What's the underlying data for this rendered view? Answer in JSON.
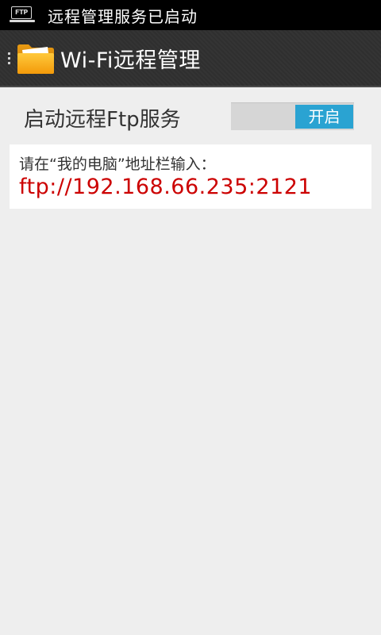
{
  "status_bar": {
    "notification_icon_text": "FTP",
    "notification_text": "远程管理服务已启动"
  },
  "action_bar": {
    "title": "Wi-Fi远程管理"
  },
  "switch_row": {
    "label": "启动远程Ftp服务",
    "toggle_label": "开启",
    "toggle_on": true
  },
  "info_card": {
    "hint": "请在“我的电脑”地址栏输入：",
    "address": "ftp://192.168.66.235:2121"
  },
  "colors": {
    "toggle_on": "#2aa3d2",
    "address_text": "#cc0000"
  }
}
